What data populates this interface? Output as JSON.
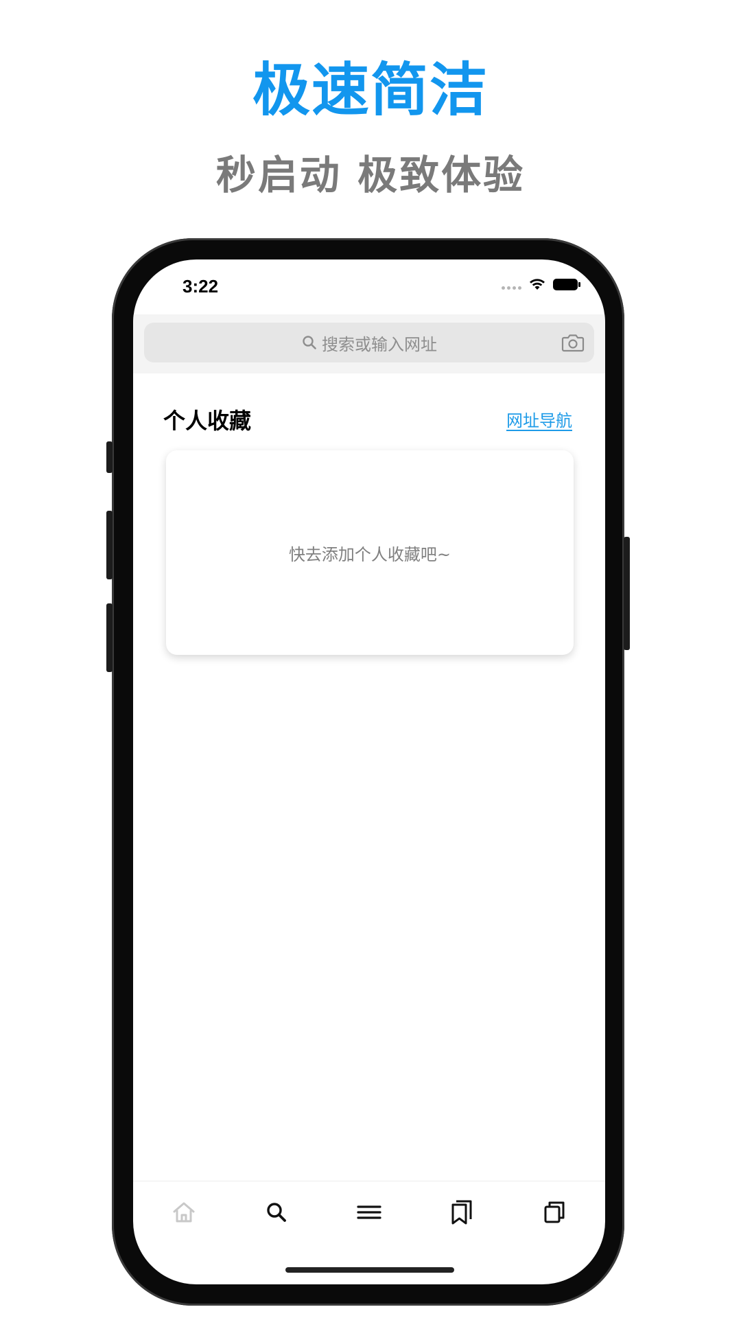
{
  "promo": {
    "headline": "极速简洁",
    "subheadline": "秒启动  极致体验",
    "headline_color": "#1296ee",
    "subheadline_color": "#7a7a7a"
  },
  "status_bar": {
    "time": "3:22",
    "icons": [
      "cellular-signal-icon",
      "wifi-icon",
      "battery-icon"
    ]
  },
  "search": {
    "placeholder": "搜索或输入网址",
    "left_icon": "search-icon",
    "right_icon": "camera-icon"
  },
  "favorites": {
    "title": "个人收藏",
    "nav_link": "网址导航",
    "empty_message": "快去添加个人收藏吧~",
    "link_color": "#1e9be8"
  },
  "tab_bar": {
    "items": [
      {
        "icon": "home-icon",
        "active": false
      },
      {
        "icon": "search-icon",
        "active": true
      },
      {
        "icon": "menu-icon",
        "active": true
      },
      {
        "icon": "bookmarks-icon",
        "active": true
      },
      {
        "icon": "tabs-icon",
        "active": true
      }
    ]
  }
}
